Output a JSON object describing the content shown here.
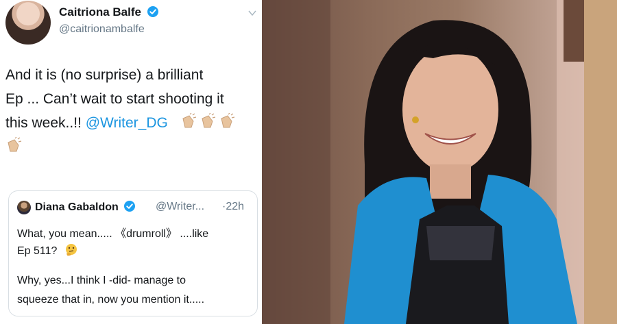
{
  "tweet": {
    "author_name": "Caitriona Balfe",
    "author_handle": "@caitrionambalfe",
    "text_lines": [
      "And it is (no surprise) a brilliant",
      "Ep ... Can’t wait to start shooting it",
      "this week..!! "
    ],
    "mention": "@Writer_DG",
    "emoji": "clapping-hands-icon"
  },
  "quoted_tweet": {
    "author_name": "Diana Gabaldon",
    "author_handle": "@Writer...",
    "time": "·22h",
    "line1": "What, you mean..... 《drumroll》 ....like",
    "line2": "Ep 511?",
    "line3": "Why, yes...I think I -did- manage to",
    "line4": "squeeze that in, now you mention it.....",
    "emoji": "thinking-face-icon"
  },
  "colors": {
    "verified_badge": "#1da1f2",
    "mention": "#1b95e0",
    "secondary_text": "#657786",
    "scarf": "#1f8fd0"
  }
}
